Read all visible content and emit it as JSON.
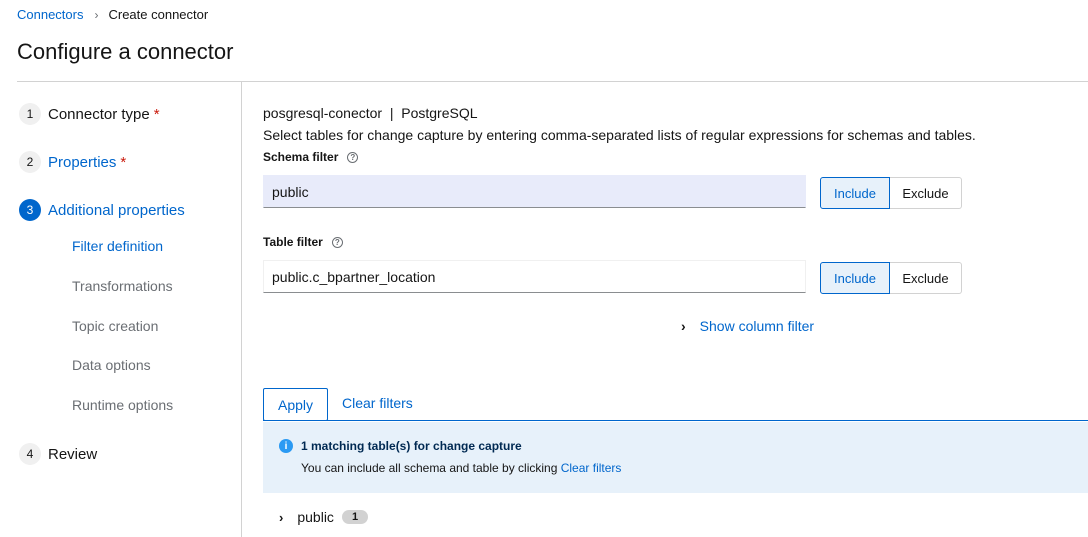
{
  "breadcrumb": {
    "parent": "Connectors",
    "separator": "›",
    "current": "Create connector"
  },
  "page": {
    "title": "Configure a connector"
  },
  "wizard": {
    "steps": [
      {
        "number": "1",
        "label": "Connector type",
        "required": "*"
      },
      {
        "number": "2",
        "label": "Properties",
        "required": "*"
      },
      {
        "number": "3",
        "label": "Additional properties"
      },
      {
        "number": "4",
        "label": "Review"
      }
    ],
    "substeps": [
      "Filter definition",
      "Transformations",
      "Topic creation",
      "Data options",
      "Runtime options"
    ]
  },
  "connector": {
    "name_line": "posgresql-conector  |  PostgreSQL",
    "description": "Select tables for change capture by entering comma-separated lists of regular expressions for schemas and tables."
  },
  "schema_filter": {
    "label": "Schema filter",
    "help_icon": "?",
    "value": "public",
    "include": "Include",
    "exclude": "Exclude"
  },
  "table_filter": {
    "label": "Table filter",
    "help_icon": "?",
    "value": "public.c_bpartner_location",
    "include": "Include",
    "exclude": "Exclude"
  },
  "column_filter": {
    "chevron": "›",
    "label": "Show column filter"
  },
  "actions": {
    "apply": "Apply",
    "clear": "Clear filters"
  },
  "alert": {
    "icon": "i",
    "title": "1 matching table(s) for change capture",
    "body_prefix": "You can include all schema and table by clicking ",
    "body_link": "Clear filters"
  },
  "results": {
    "chevron": "›",
    "schema": "public",
    "count": "1"
  },
  "colors": {
    "accent": "#0066cc",
    "required": "#c9190b",
    "alert_bg": "#e7f1fa",
    "filled_input_bg": "#e8ebfa"
  }
}
